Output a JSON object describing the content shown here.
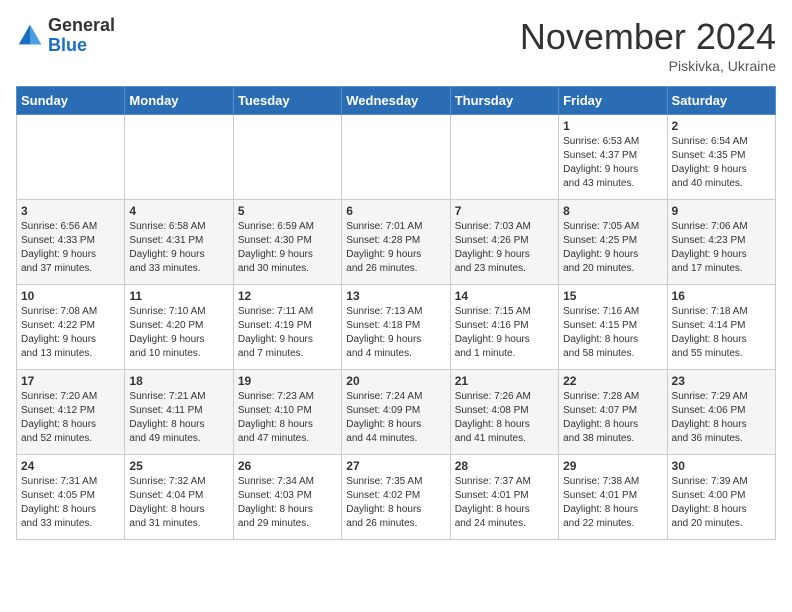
{
  "logo": {
    "general": "General",
    "blue": "Blue"
  },
  "title": "November 2024",
  "location": "Piskivka, Ukraine",
  "days_header": [
    "Sunday",
    "Monday",
    "Tuesday",
    "Wednesday",
    "Thursday",
    "Friday",
    "Saturday"
  ],
  "weeks": [
    [
      {
        "day": "",
        "info": ""
      },
      {
        "day": "",
        "info": ""
      },
      {
        "day": "",
        "info": ""
      },
      {
        "day": "",
        "info": ""
      },
      {
        "day": "",
        "info": ""
      },
      {
        "day": "1",
        "info": "Sunrise: 6:53 AM\nSunset: 4:37 PM\nDaylight: 9 hours\nand 43 minutes."
      },
      {
        "day": "2",
        "info": "Sunrise: 6:54 AM\nSunset: 4:35 PM\nDaylight: 9 hours\nand 40 minutes."
      }
    ],
    [
      {
        "day": "3",
        "info": "Sunrise: 6:56 AM\nSunset: 4:33 PM\nDaylight: 9 hours\nand 37 minutes."
      },
      {
        "day": "4",
        "info": "Sunrise: 6:58 AM\nSunset: 4:31 PM\nDaylight: 9 hours\nand 33 minutes."
      },
      {
        "day": "5",
        "info": "Sunrise: 6:59 AM\nSunset: 4:30 PM\nDaylight: 9 hours\nand 30 minutes."
      },
      {
        "day": "6",
        "info": "Sunrise: 7:01 AM\nSunset: 4:28 PM\nDaylight: 9 hours\nand 26 minutes."
      },
      {
        "day": "7",
        "info": "Sunrise: 7:03 AM\nSunset: 4:26 PM\nDaylight: 9 hours\nand 23 minutes."
      },
      {
        "day": "8",
        "info": "Sunrise: 7:05 AM\nSunset: 4:25 PM\nDaylight: 9 hours\nand 20 minutes."
      },
      {
        "day": "9",
        "info": "Sunrise: 7:06 AM\nSunset: 4:23 PM\nDaylight: 9 hours\nand 17 minutes."
      }
    ],
    [
      {
        "day": "10",
        "info": "Sunrise: 7:08 AM\nSunset: 4:22 PM\nDaylight: 9 hours\nand 13 minutes."
      },
      {
        "day": "11",
        "info": "Sunrise: 7:10 AM\nSunset: 4:20 PM\nDaylight: 9 hours\nand 10 minutes."
      },
      {
        "day": "12",
        "info": "Sunrise: 7:11 AM\nSunset: 4:19 PM\nDaylight: 9 hours\nand 7 minutes."
      },
      {
        "day": "13",
        "info": "Sunrise: 7:13 AM\nSunset: 4:18 PM\nDaylight: 9 hours\nand 4 minutes."
      },
      {
        "day": "14",
        "info": "Sunrise: 7:15 AM\nSunset: 4:16 PM\nDaylight: 9 hours\nand 1 minute."
      },
      {
        "day": "15",
        "info": "Sunrise: 7:16 AM\nSunset: 4:15 PM\nDaylight: 8 hours\nand 58 minutes."
      },
      {
        "day": "16",
        "info": "Sunrise: 7:18 AM\nSunset: 4:14 PM\nDaylight: 8 hours\nand 55 minutes."
      }
    ],
    [
      {
        "day": "17",
        "info": "Sunrise: 7:20 AM\nSunset: 4:12 PM\nDaylight: 8 hours\nand 52 minutes."
      },
      {
        "day": "18",
        "info": "Sunrise: 7:21 AM\nSunset: 4:11 PM\nDaylight: 8 hours\nand 49 minutes."
      },
      {
        "day": "19",
        "info": "Sunrise: 7:23 AM\nSunset: 4:10 PM\nDaylight: 8 hours\nand 47 minutes."
      },
      {
        "day": "20",
        "info": "Sunrise: 7:24 AM\nSunset: 4:09 PM\nDaylight: 8 hours\nand 44 minutes."
      },
      {
        "day": "21",
        "info": "Sunrise: 7:26 AM\nSunset: 4:08 PM\nDaylight: 8 hours\nand 41 minutes."
      },
      {
        "day": "22",
        "info": "Sunrise: 7:28 AM\nSunset: 4:07 PM\nDaylight: 8 hours\nand 38 minutes."
      },
      {
        "day": "23",
        "info": "Sunrise: 7:29 AM\nSunset: 4:06 PM\nDaylight: 8 hours\nand 36 minutes."
      }
    ],
    [
      {
        "day": "24",
        "info": "Sunrise: 7:31 AM\nSunset: 4:05 PM\nDaylight: 8 hours\nand 33 minutes."
      },
      {
        "day": "25",
        "info": "Sunrise: 7:32 AM\nSunset: 4:04 PM\nDaylight: 8 hours\nand 31 minutes."
      },
      {
        "day": "26",
        "info": "Sunrise: 7:34 AM\nSunset: 4:03 PM\nDaylight: 8 hours\nand 29 minutes."
      },
      {
        "day": "27",
        "info": "Sunrise: 7:35 AM\nSunset: 4:02 PM\nDaylight: 8 hours\nand 26 minutes."
      },
      {
        "day": "28",
        "info": "Sunrise: 7:37 AM\nSunset: 4:01 PM\nDaylight: 8 hours\nand 24 minutes."
      },
      {
        "day": "29",
        "info": "Sunrise: 7:38 AM\nSunset: 4:01 PM\nDaylight: 8 hours\nand 22 minutes."
      },
      {
        "day": "30",
        "info": "Sunrise: 7:39 AM\nSunset: 4:00 PM\nDaylight: 8 hours\nand 20 minutes."
      }
    ]
  ]
}
